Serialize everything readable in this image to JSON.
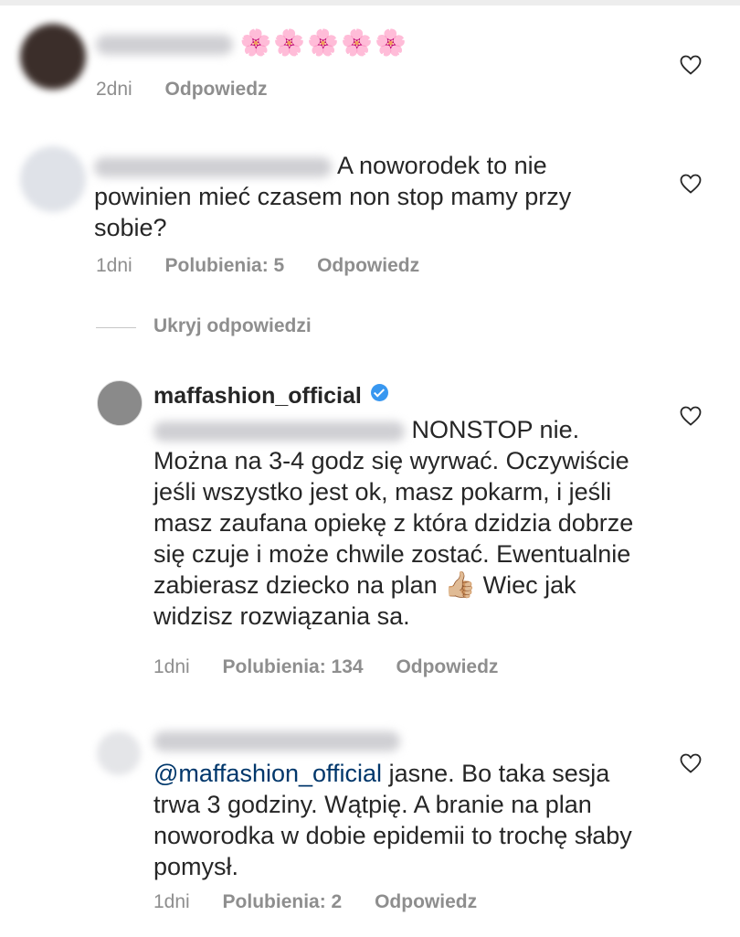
{
  "comments": [
    {
      "text": "",
      "emoji": "🌸🌸🌸🌸🌸",
      "age": "2dni",
      "likes": "",
      "reply": "Odpowiedz"
    },
    {
      "text": "A noworodek to nie powinien mieć czasem non stop mamy przy sobie?",
      "age": "1dni",
      "likes": "Polubienia: 5",
      "reply": "Odpowiedz"
    },
    {
      "hide_replies": "Ukryj odpowiedzi"
    },
    {
      "username": "maffashion_official",
      "text_first": "NONSTOP nie.",
      "text_rest": "Można na 3-4 godz się wyrwać. Oczywiście jeśli wszystko jest ok, masz pokarm, i jeśli masz zaufana opiekę z która dzidzia dobrze się czuje i może chwile zostać. Ewentualnie zabierasz dziecko na plan",
      "thumb": "👍🏼",
      "text_after": "Wiec jak widzisz rozwiązania sa.",
      "age": "1dni",
      "likes": "Polubienia: 134",
      "reply": "Odpowiedz"
    },
    {
      "mention": "@maffashion_official",
      "text": "jasne. Bo taka sesja trwa 3 godziny. Wątpię. A branie na plan noworodka w dobie epidemii to trochę słaby pomysł.",
      "age": "1dni",
      "likes": "Polubienia: 2",
      "reply": "Odpowiedz"
    }
  ]
}
